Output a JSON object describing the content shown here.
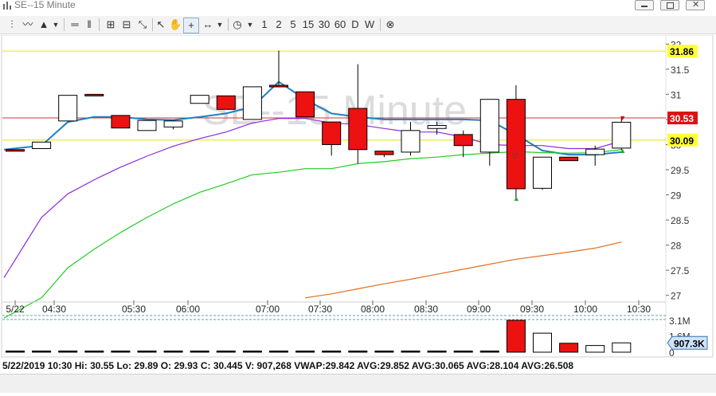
{
  "window": {
    "title": "SE--15 Minute"
  },
  "toolbar": {
    "periods": [
      "1",
      "2",
      "5",
      "15",
      "30",
      "60",
      "D",
      "W"
    ]
  },
  "chart_data": {
    "type": "candlestick",
    "watermark": "SE--15 Minute",
    "price_axis": {
      "min": 26.9,
      "max": 32.1,
      "ticks": [
        "32",
        "31.5",
        "31",
        "30.5",
        "30",
        "29.5",
        "29",
        "28.5",
        "28",
        "27.5",
        "27"
      ]
    },
    "time_labels": [
      "5/22",
      "04:30",
      "05:30",
      "06:00",
      "07:00",
      "07:30",
      "08:00",
      "08:30",
      "09:00",
      "09:30",
      "10:00",
      "10:30"
    ],
    "candles": [
      {
        "o": 29.9,
        "h": 29.9,
        "l": 29.9,
        "c": 29.9,
        "up": false
      },
      {
        "o": 29.92,
        "h": 30.05,
        "l": 29.92,
        "c": 30.05,
        "up": true
      },
      {
        "o": 30.47,
        "h": 30.98,
        "l": 30.47,
        "c": 30.98,
        "up": true
      },
      {
        "o": 31.0,
        "h": 31.0,
        "l": 31.0,
        "c": 31.0,
        "up": false
      },
      {
        "o": 30.58,
        "h": 30.58,
        "l": 30.33,
        "c": 30.33,
        "up": false
      },
      {
        "o": 30.48,
        "h": 30.48,
        "l": 30.28,
        "c": 30.28,
        "up": true
      },
      {
        "o": 30.35,
        "h": 30.48,
        "l": 30.3,
        "c": 30.47,
        "up": true
      },
      {
        "o": 30.82,
        "h": 30.98,
        "l": 30.82,
        "c": 30.98,
        "up": true
      },
      {
        "o": 30.97,
        "h": 30.97,
        "l": 30.7,
        "c": 30.7,
        "up": false
      },
      {
        "o": 30.5,
        "h": 31.15,
        "l": 30.5,
        "c": 31.15,
        "up": true
      },
      {
        "o": 31.18,
        "h": 31.87,
        "l": 31.18,
        "c": 31.18,
        "up": false
      },
      {
        "o": 31.05,
        "h": 31.05,
        "l": 30.55,
        "c": 30.55,
        "up": false
      },
      {
        "o": 30.45,
        "h": 30.45,
        "l": 29.78,
        "c": 30.0,
        "up": false
      },
      {
        "o": 30.72,
        "h": 31.6,
        "l": 29.62,
        "c": 29.9,
        "up": false
      },
      {
        "o": 29.87,
        "h": 29.87,
        "l": 29.75,
        "c": 29.8,
        "up": false
      },
      {
        "o": 29.85,
        "h": 30.45,
        "l": 29.78,
        "c": 30.28,
        "up": true
      },
      {
        "o": 30.32,
        "h": 30.45,
        "l": 30.2,
        "c": 30.38,
        "up": true
      },
      {
        "o": 30.2,
        "h": 30.28,
        "l": 29.75,
        "c": 29.98,
        "up": false
      },
      {
        "o": 29.85,
        "h": 30.65,
        "l": 29.58,
        "c": 30.9,
        "up": true
      },
      {
        "o": 30.9,
        "h": 31.18,
        "l": 28.9,
        "c": 29.12,
        "up": false
      },
      {
        "o": 29.13,
        "h": 29.75,
        "l": 29.1,
        "c": 29.75,
        "up": true
      },
      {
        "o": 29.75,
        "h": 29.75,
        "l": 29.68,
        "c": 29.68,
        "up": false
      },
      {
        "o": 29.8,
        "h": 29.98,
        "l": 29.58,
        "c": 29.91,
        "up": true
      },
      {
        "o": 29.93,
        "h": 30.55,
        "l": 29.89,
        "c": 30.445,
        "up": true
      }
    ],
    "series": [
      {
        "name": "AVG:29.852",
        "color": "#1f7fc1",
        "values": [
          29.9,
          29.98,
          30.45,
          30.55,
          30.55,
          30.5,
          30.49,
          30.55,
          30.62,
          30.75,
          31.25,
          30.9,
          30.62,
          30.55,
          30.5,
          30.5,
          30.5,
          30.5,
          30.48,
          30.2,
          29.88,
          29.8,
          29.8,
          29.85
        ]
      },
      {
        "name": "AVG:30.065",
        "color": "#8a2be2",
        "values": [
          27.35,
          28.55,
          29.02,
          29.3,
          29.55,
          29.77,
          29.97,
          30.12,
          30.25,
          30.43,
          30.52,
          30.52,
          30.43,
          30.4,
          30.32,
          30.25,
          30.25,
          30.15,
          30.0,
          29.98,
          29.98,
          29.92,
          29.92,
          30.07
        ]
      },
      {
        "name": "AVG:28.104",
        "color": "#22cc22",
        "values": [
          26.55,
          26.95,
          27.55,
          27.92,
          28.25,
          28.55,
          28.82,
          29.05,
          29.22,
          29.4,
          29.45,
          29.52,
          29.52,
          29.62,
          29.66,
          29.72,
          29.75,
          29.8,
          29.83,
          29.86,
          29.84,
          29.83,
          29.84,
          29.9
        ]
      },
      {
        "name": "AVG:26.508",
        "color": "#e07020",
        "start": 11,
        "values": [
          null,
          null,
          null,
          null,
          null,
          null,
          null,
          null,
          null,
          null,
          null,
          26.95,
          27.03,
          27.13,
          27.23,
          27.32,
          27.42,
          27.52,
          27.62,
          27.72,
          27.79,
          27.86,
          27.94,
          28.06
        ]
      }
    ],
    "hlines": [
      {
        "value": 31.86,
        "color": "#e6e600",
        "label": "31.86",
        "label_bg": "#ffff33"
      },
      {
        "value": 30.53,
        "color": "#c83a3a",
        "label": "30.53",
        "label_bg": "#dd1111"
      },
      {
        "value": 30.09,
        "color": "#e6e600",
        "label": "30.09",
        "label_bg": "#ffff33"
      }
    ],
    "volume": {
      "axis_ticks": [
        "3.1M",
        "1.6M",
        "0"
      ],
      "last_label": "907.3K",
      "values": [
        5000,
        5000,
        5000,
        5000,
        5000,
        5000,
        5000,
        5000,
        5000,
        5000,
        5000,
        5000,
        5000,
        5000,
        5000,
        5000,
        5000,
        5000,
        60000,
        3100000,
        1850000,
        870000,
        650000,
        907268
      ],
      "colors": [
        "flat",
        "flat",
        "flat",
        "flat",
        "flat",
        "flat",
        "flat",
        "flat",
        "flat",
        "flat",
        "flat",
        "flat",
        "flat",
        "flat",
        "flat",
        "flat",
        "flat",
        "flat",
        "flat",
        "red",
        "white",
        "red",
        "white",
        "white"
      ]
    }
  },
  "status": {
    "text": "5/22/2019 10:30   Hi: 30.55   Lo: 29.89   O: 29.93   C: 30.445   V: 907,268  VWAP:29.842  AVG:29.852  AVG:30.065  AVG:28.104  AVG:26.508"
  }
}
